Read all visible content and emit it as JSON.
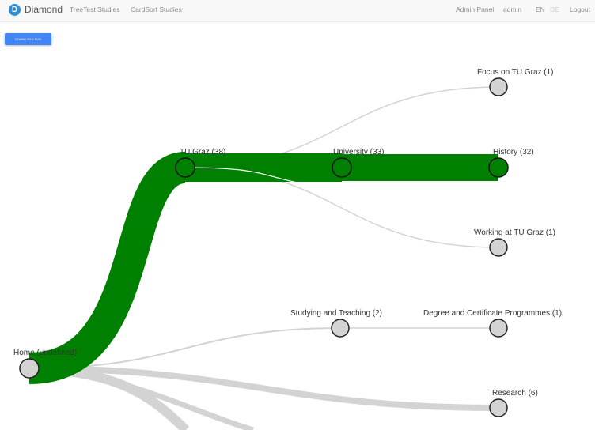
{
  "navbar": {
    "logo_letter": "D",
    "brand": "Diamond",
    "links": [
      "TreeTest Studies",
      "CardSort Studies"
    ],
    "right": {
      "admin_panel": "Admin Panel",
      "user": "admin",
      "lang_en": "EN",
      "lang_de": "DE",
      "logout": "Logout"
    }
  },
  "toolbar": {
    "download_label": "DOWNLOAD SVG"
  },
  "colors": {
    "main_path": "#008000",
    "minor_path": "#d3d3d3",
    "node_fill": "#d3d3d3"
  },
  "tree": {
    "nodes": [
      {
        "id": "home",
        "label": "Home (undefined)"
      },
      {
        "id": "tugraz",
        "label": "TU Graz (38)"
      },
      {
        "id": "university",
        "label": "University (33)"
      },
      {
        "id": "history",
        "label": "History (32)"
      },
      {
        "id": "focus",
        "label": "Focus on TU Graz (1)"
      },
      {
        "id": "working",
        "label": "Working at TU Graz (1)"
      },
      {
        "id": "studying",
        "label": "Studying and Teaching (2)"
      },
      {
        "id": "degree",
        "label": "Degree and Certificate Programmes (1)"
      },
      {
        "id": "research",
        "label": "Research (6)"
      }
    ]
  }
}
